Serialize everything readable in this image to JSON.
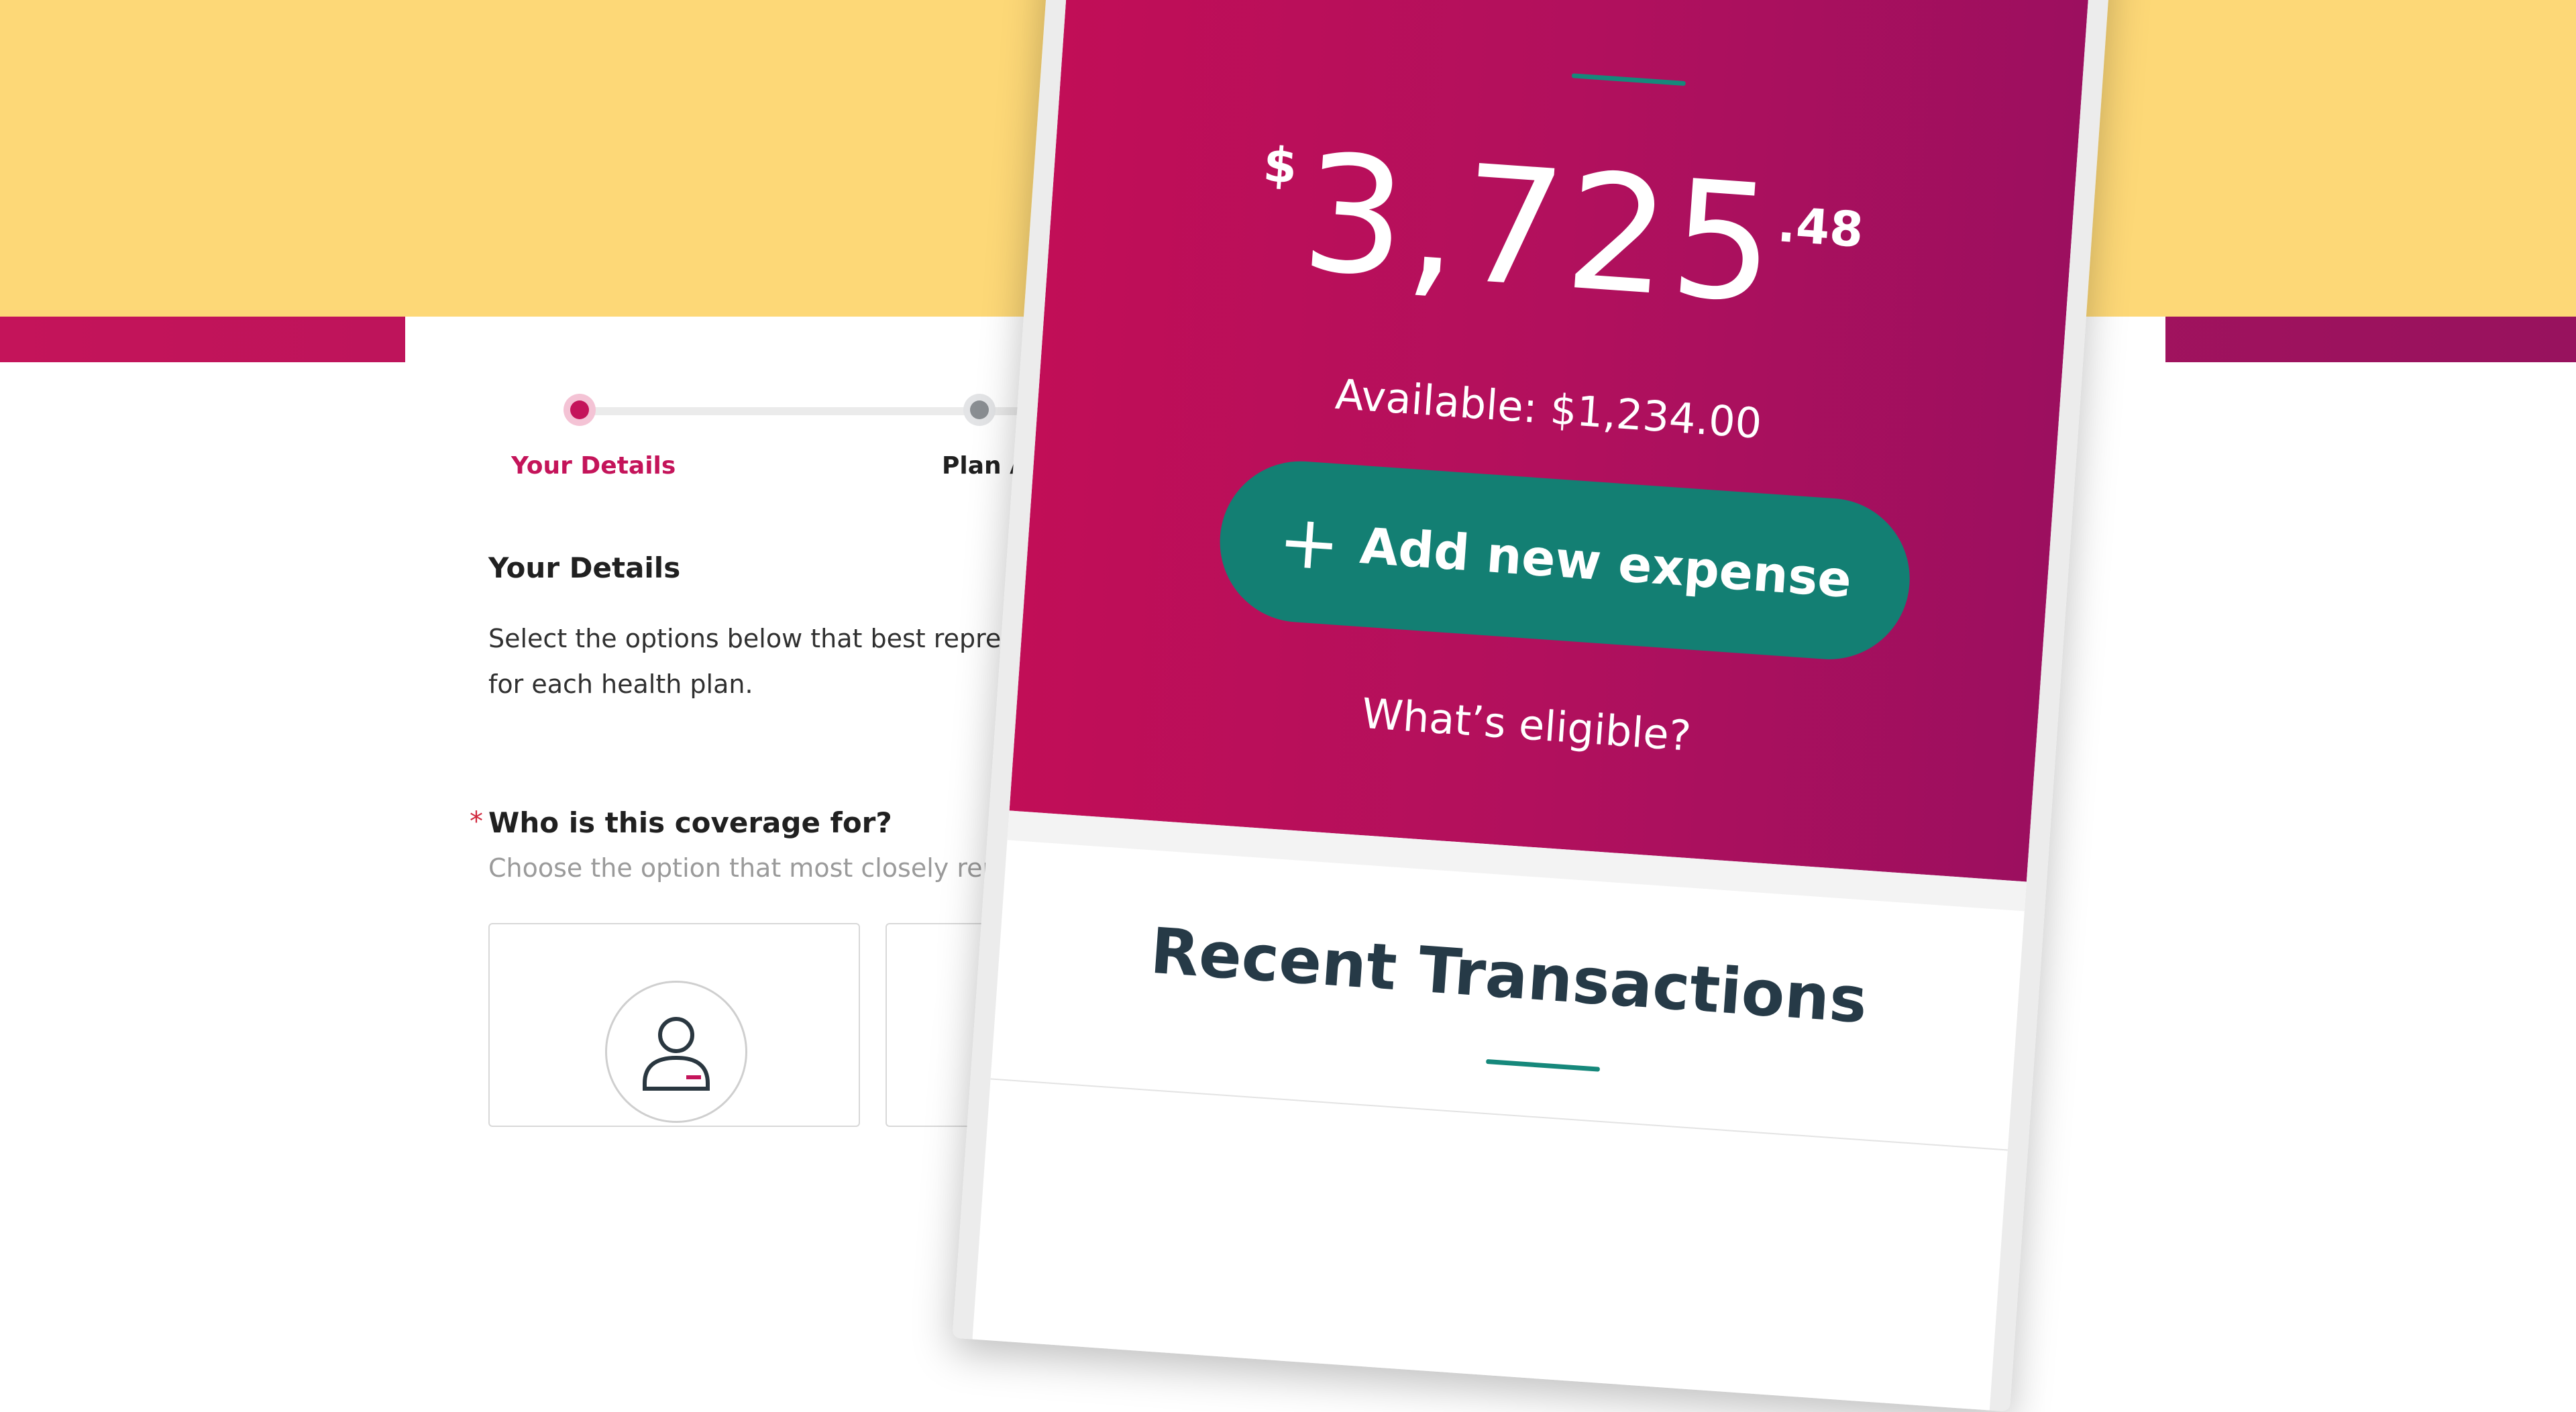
{
  "form": {
    "steps": [
      {
        "label": "Your Details",
        "active": true
      },
      {
        "label": "Plan A",
        "active": false
      }
    ],
    "section_title": "Your Details",
    "section_desc": "Select the options below that best represent spend for each health plan.",
    "required_mark": "*",
    "coverage_question": "Who is this coverage for?",
    "coverage_hint": "Choose the option that most closely repres"
  },
  "phone": {
    "balance": {
      "currency": "$",
      "whole": "3,725",
      "cents": ".48"
    },
    "available": "Available: $1,234.00",
    "add_button_icon": "+",
    "add_button_label": "Add new expense",
    "eligible_link": "What’s eligible?",
    "recent_title": "Recent Transactions"
  },
  "colors": {
    "brand_magenta": "#c4145a",
    "teal": "#137f73",
    "yellow": "#fdd877",
    "dark_text": "#263a47"
  }
}
